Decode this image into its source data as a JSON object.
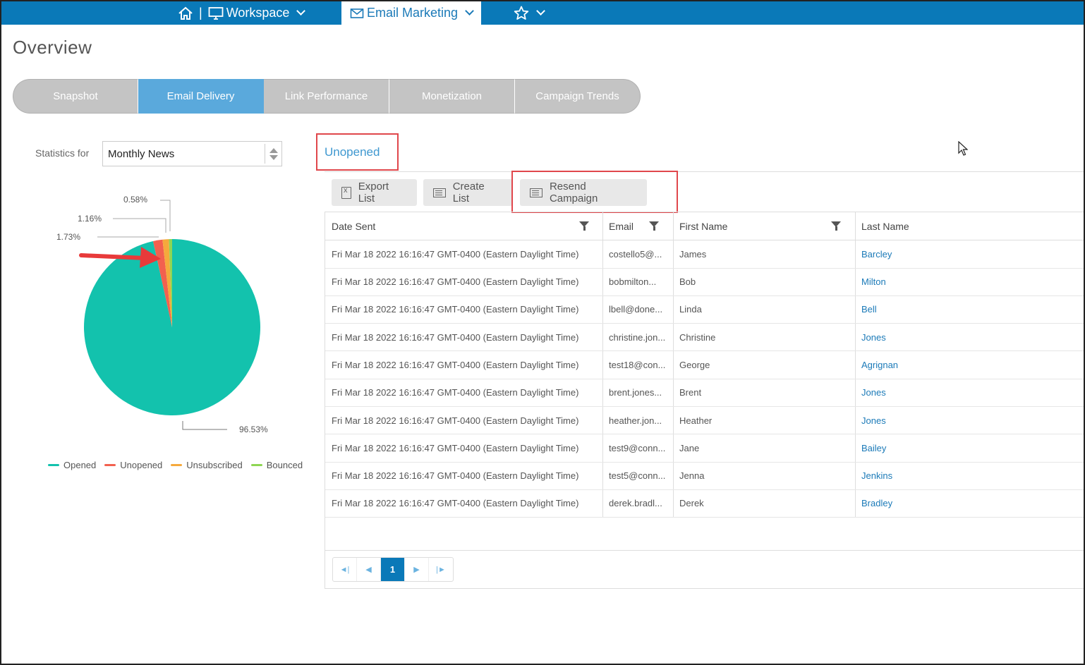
{
  "topnav": {
    "workspace_label": "Workspace",
    "email_marketing_label": "Email Marketing",
    "separator": "|"
  },
  "page_title": "Overview",
  "tabs": [
    {
      "label": "Snapshot",
      "active": false
    },
    {
      "label": "Email Delivery",
      "active": true
    },
    {
      "label": "Link Performance",
      "active": false
    },
    {
      "label": "Monetization",
      "active": false
    },
    {
      "label": "Campaign Trends",
      "active": false
    }
  ],
  "stats": {
    "label": "Statistics for",
    "selected": "Monthly News"
  },
  "chart_data": {
    "type": "pie",
    "categories": [
      "Opened",
      "Unopened",
      "Unsubscribed",
      "Bounced"
    ],
    "values": [
      96.53,
      1.73,
      1.16,
      0.58
    ],
    "labels": [
      "96.53%",
      "1.73%",
      "1.16%",
      "0.58%"
    ],
    "colors": [
      "#13c2ad",
      "#f2614f",
      "#f5a93c",
      "#8ed653"
    ],
    "legend_position": "bottom"
  },
  "section_title": "Unopened",
  "toolbar": {
    "export_label": "Export List",
    "create_label": "Create List",
    "resend_label": "Resend Campaign"
  },
  "table": {
    "columns": [
      "Date Sent",
      "Email",
      "First Name",
      "Last Name"
    ],
    "rows": [
      {
        "date": "Fri Mar 18 2022 16:16:47 GMT-0400 (Eastern Daylight Time)",
        "email": "costello5@...",
        "first": "James",
        "last": "Barcley"
      },
      {
        "date": "Fri Mar 18 2022 16:16:47 GMT-0400 (Eastern Daylight Time)",
        "email": "bobmilton...",
        "first": "Bob",
        "last": "Milton"
      },
      {
        "date": "Fri Mar 18 2022 16:16:47 GMT-0400 (Eastern Daylight Time)",
        "email": "lbell@done...",
        "first": "Linda",
        "last": "Bell"
      },
      {
        "date": "Fri Mar 18 2022 16:16:47 GMT-0400 (Eastern Daylight Time)",
        "email": "christine.jon...",
        "first": "Christine",
        "last": "Jones"
      },
      {
        "date": "Fri Mar 18 2022 16:16:47 GMT-0400 (Eastern Daylight Time)",
        "email": "test18@con...",
        "first": "George",
        "last": "Agrignan"
      },
      {
        "date": "Fri Mar 18 2022 16:16:47 GMT-0400 (Eastern Daylight Time)",
        "email": "brent.jones...",
        "first": "Brent",
        "last": "Jones"
      },
      {
        "date": "Fri Mar 18 2022 16:16:47 GMT-0400 (Eastern Daylight Time)",
        "email": "heather.jon...",
        "first": "Heather",
        "last": "Jones"
      },
      {
        "date": "Fri Mar 18 2022 16:16:47 GMT-0400 (Eastern Daylight Time)",
        "email": "test9@conn...",
        "first": "Jane",
        "last": "Bailey"
      },
      {
        "date": "Fri Mar 18 2022 16:16:47 GMT-0400 (Eastern Daylight Time)",
        "email": "test5@conn...",
        "first": "Jenna",
        "last": "Jenkins"
      },
      {
        "date": "Fri Mar 18 2022 16:16:47 GMT-0400 (Eastern Daylight Time)",
        "email": "derek.bradl...",
        "first": "Derek",
        "last": "Bradley"
      }
    ]
  },
  "pagination": {
    "current_page": "1",
    "icons": [
      "first-page-icon",
      "prev-page-icon",
      "next-page-icon",
      "last-page-icon"
    ]
  },
  "colors": {
    "brand": "#0a79b8",
    "accent": "#5aa9dc",
    "highlight": "#e0474c"
  }
}
